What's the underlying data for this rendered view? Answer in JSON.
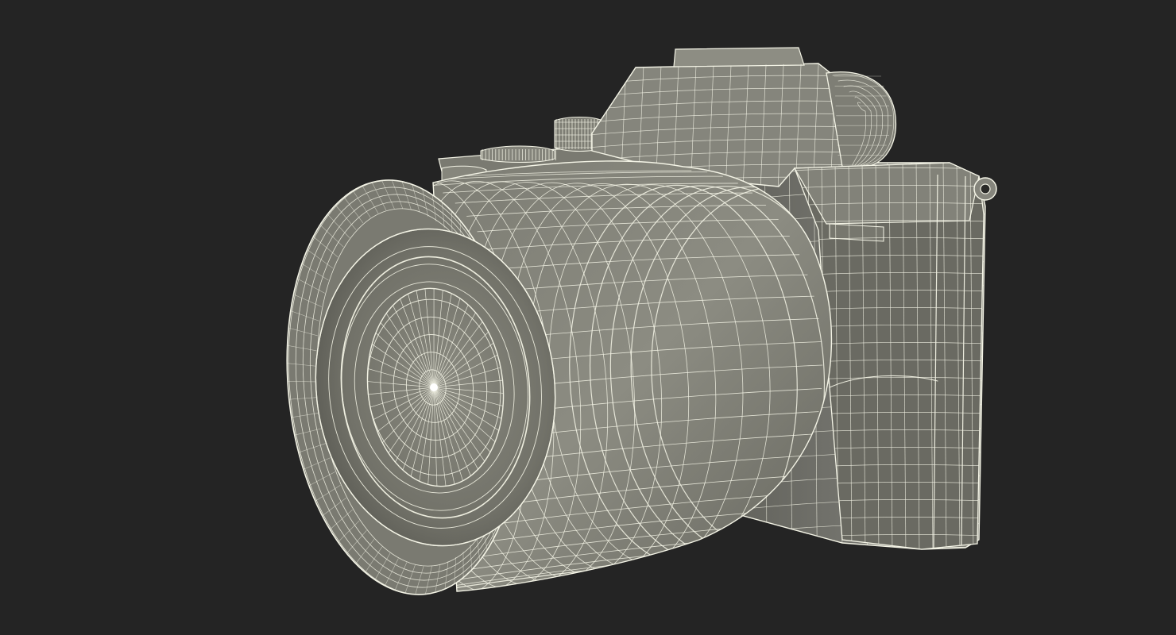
{
  "scene": {
    "subject": "camera-wireframe",
    "background_color": "#242424",
    "surface_color": "#6f6f66",
    "surface_light": "#8a8a80",
    "surface_dark": "#4e4e47",
    "wire_color": "#f4f4e6",
    "lens_radial_segments": 48,
    "lens_ring_count": 9,
    "barrel_longitudinal_lines": 26,
    "barrel_circumferential_lines": 14,
    "body_grid_columns": 12,
    "body_grid_rows": 16
  }
}
